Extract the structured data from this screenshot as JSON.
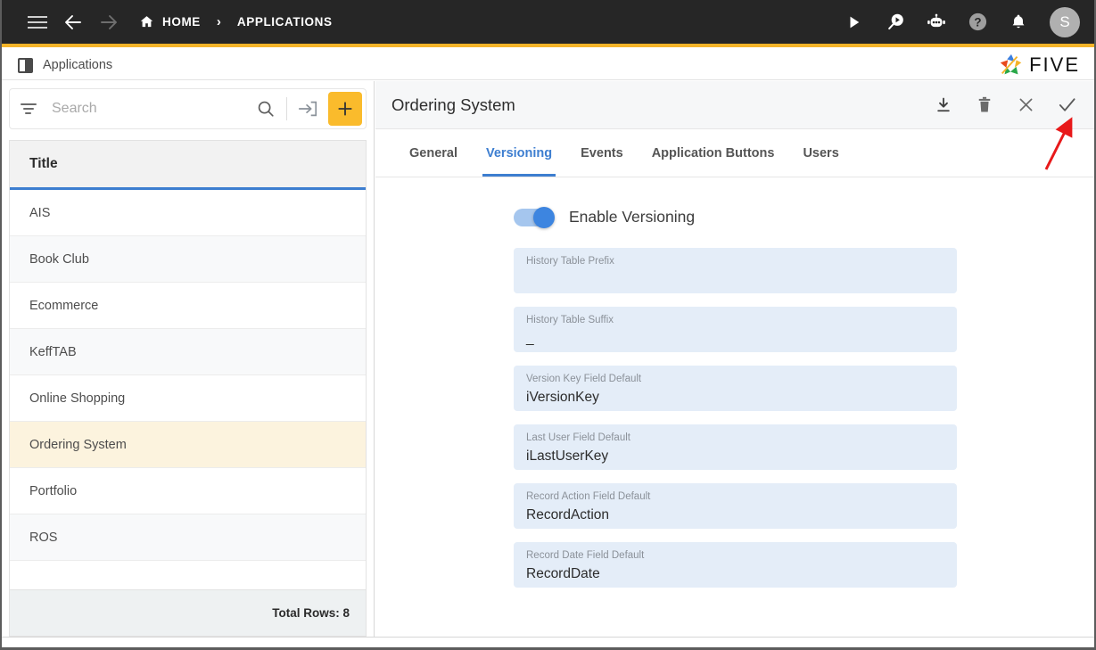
{
  "topbar": {
    "menu_icon": "hamburger-icon",
    "back_icon": "arrow-left-icon",
    "forward_icon": "arrow-right-icon",
    "home_icon": "home-icon",
    "breadcrumb": [
      "HOME",
      "APPLICATIONS"
    ],
    "separator": "›",
    "actions": [
      {
        "name": "run-icon",
        "glyph": "play"
      },
      {
        "name": "search-run-icon",
        "glyph": "search-play"
      },
      {
        "name": "chatbot-icon",
        "glyph": "robot"
      },
      {
        "name": "help-icon",
        "glyph": "question"
      },
      {
        "name": "notifications-icon",
        "glyph": "bell"
      }
    ],
    "avatar_initial": "S",
    "accent_color": "#f5b429",
    "background_color": "#262626"
  },
  "strip": {
    "tab_label": "Applications",
    "tab_icon": "panel-icon",
    "logo_text": "FIVE"
  },
  "left_panel": {
    "search": {
      "placeholder": "Search",
      "value": "",
      "filter_icon": "filter-icon",
      "search_icon": "search-icon",
      "import_icon": "import-icon",
      "add_label": "+",
      "add_color": "#fabb2c"
    },
    "grid": {
      "column_header": "Title",
      "header_underline_color": "#3d7ed0",
      "selected_row_color": "#fcf3de",
      "rows": [
        {
          "title": "AIS",
          "selected": false
        },
        {
          "title": "Book Club",
          "selected": false
        },
        {
          "title": "Ecommerce",
          "selected": false
        },
        {
          "title": "KeffTAB",
          "selected": false
        },
        {
          "title": "Online Shopping",
          "selected": false
        },
        {
          "title": "Ordering System",
          "selected": true
        },
        {
          "title": "Portfolio",
          "selected": false
        },
        {
          "title": "ROS",
          "selected": false
        }
      ],
      "footer_text": "Total Rows: 8"
    }
  },
  "detail": {
    "title": "Ordering System",
    "actions": [
      {
        "name": "download-icon",
        "glyph": "download"
      },
      {
        "name": "delete-icon",
        "glyph": "trash"
      },
      {
        "name": "close-icon",
        "glyph": "x"
      },
      {
        "name": "save-icon",
        "glyph": "check"
      }
    ],
    "tabs": [
      {
        "label": "General",
        "active": false
      },
      {
        "label": "Versioning",
        "active": true
      },
      {
        "label": "Events",
        "active": false
      },
      {
        "label": "Application Buttons",
        "active": false
      },
      {
        "label": "Users",
        "active": false
      }
    ],
    "active_tab_color": "#3d7ed0",
    "versioning": {
      "toggle": {
        "label": "Enable Versioning",
        "enabled": true,
        "on_color": "#3d85e0"
      },
      "fields": [
        {
          "label": "History Table Prefix",
          "value": ""
        },
        {
          "label": "History Table Suffix",
          "value": "_"
        },
        {
          "label": "Version Key Field Default",
          "value": "iVersionKey"
        },
        {
          "label": "Last User Field Default",
          "value": "iLastUserKey"
        },
        {
          "label": "Record Action Field Default",
          "value": "RecordAction"
        },
        {
          "label": "Record Date Field Default",
          "value": "RecordDate"
        }
      ],
      "field_background": "#e4edf8"
    }
  },
  "annotation": {
    "arrow_color": "#e8191a",
    "points_at": "save-icon"
  }
}
